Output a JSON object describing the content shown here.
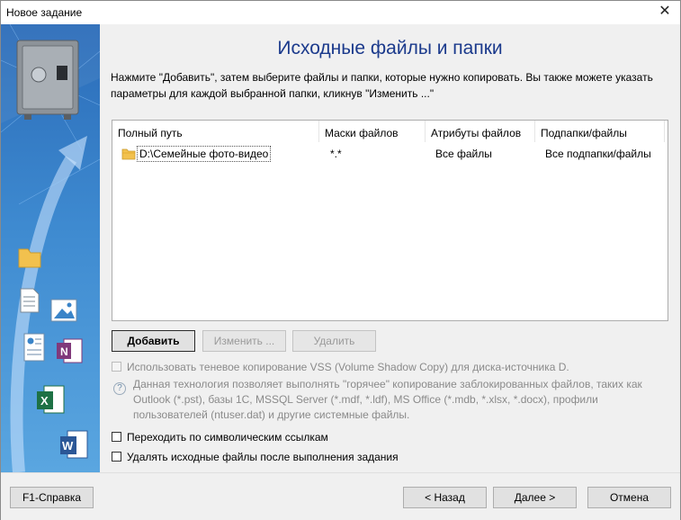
{
  "window": {
    "title": "Новое задание",
    "close_glyph": "✕"
  },
  "heading": "Исходные файлы и папки",
  "instructions": "Нажмите \"Добавить\", затем выберите файлы и папки, которые нужно копировать. Вы также можете указать параметры для каждой выбранной папки, кликнув \"Изменить ...\"",
  "table": {
    "columns": [
      "Полный путь",
      "Маски файлов",
      "Атрибуты файлов",
      "Подпапки/файлы"
    ],
    "rows": [
      {
        "path": "D:\\Семейные фото-видео",
        "masks": "*.*",
        "attributes": "Все файлы",
        "subfolders": "Все подпапки/файлы"
      }
    ]
  },
  "buttons": {
    "add": "Добавить",
    "edit": "Изменить ...",
    "delete": "Удалить"
  },
  "vss": {
    "label": "Использовать теневое копирование VSS (Volume Shadow Copy) для диска-источника D.",
    "checked": false,
    "enabled": false,
    "info": "Данная технология позволяет выполнять \"горячее\" копирование заблокированных файлов, таких как Outlook (*.pst), базы 1С, MSSQL Server (*.mdf, *.ldf), MS Office (*.mdb, *.xlsx, *.docx), профили пользователей (ntuser.dat) и другие системные файлы."
  },
  "options": [
    {
      "label": "Переходить по символическим ссылкам",
      "checked": false
    },
    {
      "label": "Удалять исходные файлы после выполнения задания",
      "checked": false
    }
  ],
  "footer": {
    "help": "F1-Справка",
    "back": "< Назад",
    "next": "Далее >",
    "cancel": "Отмена"
  },
  "side_icons": [
    "safe-icon",
    "folder-icon",
    "document-icon",
    "image-icon",
    "contact-icon",
    "onenote-icon",
    "excel-icon",
    "word-icon"
  ],
  "colors": {
    "accent_heading": "#1b3a8c",
    "side_panel": "#3e8ad0",
    "excel": "#1e7145",
    "word": "#2b5797",
    "onenote": "#80397b"
  }
}
